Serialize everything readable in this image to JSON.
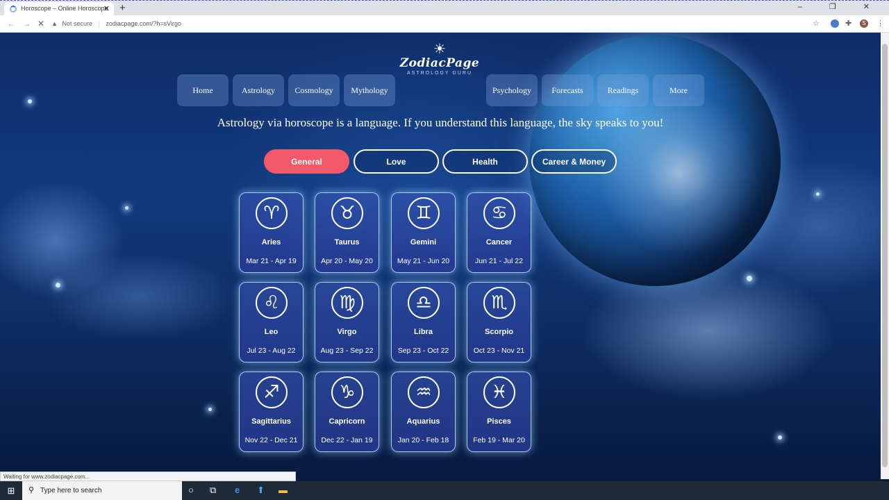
{
  "browser": {
    "tab_title": "Horoscope – Online Horoscope",
    "tab_close": "✕",
    "new_tab": "+",
    "window_controls": "–  ❐  ✕",
    "back": "←",
    "forward": "→",
    "reload": "✕",
    "security_icon": "▲",
    "not_secure": "Not secure",
    "separator": "|",
    "url": "zodiacpage.com/?h=sVirgo",
    "star": "☆",
    "puzzle": "✚",
    "menu": "⋮",
    "profile": "S",
    "status": "Waiting for www.zodiacpage.com..."
  },
  "logo": {
    "sun": "☀",
    "name": "ZodiacPage",
    "tagline": "ASTROLOGY GURU"
  },
  "nav": {
    "left": [
      "Home",
      "Astrology",
      "Cosmology",
      "Mythology"
    ],
    "right": [
      "Psychology",
      "Forecasts",
      "Readings",
      "More"
    ]
  },
  "tagline": "Astrology via horoscope is a language. If you understand this language, the sky speaks to you!",
  "categories": [
    {
      "label": "General",
      "active": true
    },
    {
      "label": "Love",
      "active": false
    },
    {
      "label": "Health",
      "active": false
    },
    {
      "label": "Career & Money",
      "active": false
    }
  ],
  "signs": [
    {
      "name": "Aries",
      "dates": "Mar 21 - Apr 19",
      "symbol": "♈"
    },
    {
      "name": "Taurus",
      "dates": "Apr 20 - May 20",
      "symbol": "♉"
    },
    {
      "name": "Gemini",
      "dates": "May 21 - Jun 20",
      "symbol": "♊"
    },
    {
      "name": "Cancer",
      "dates": "Jun 21 - Jul 22",
      "symbol": "♋"
    },
    {
      "name": "Leo",
      "dates": "Jul 23 - Aug 22",
      "symbol": "♌"
    },
    {
      "name": "Virgo",
      "dates": "Aug 23 - Sep 22",
      "symbol": "♍"
    },
    {
      "name": "Libra",
      "dates": "Sep 23 - Oct 22",
      "symbol": "♎"
    },
    {
      "name": "Scorpio",
      "dates": "Oct 23 - Nov 21",
      "symbol": "♏"
    },
    {
      "name": "Sagittarius",
      "dates": "Nov 22 - Dec 21",
      "symbol": "♐"
    },
    {
      "name": "Capricorn",
      "dates": "Dec 22 - Jan 19",
      "symbol": "♑"
    },
    {
      "name": "Aquarius",
      "dates": "Jan 20 - Feb 18",
      "symbol": "♒"
    },
    {
      "name": "Pisces",
      "dates": "Feb 19 - Mar 20",
      "symbol": "♓"
    }
  ],
  "taskbar": {
    "start_icon": "⊞",
    "search_icon": "⚲",
    "search_placeholder": "Type here to search",
    "cortana": "○",
    "taskview": "⧉",
    "edge": "e",
    "store": "⬆",
    "explorer": "▬"
  },
  "colors": {
    "accent_active_pill": "#f4596a"
  }
}
